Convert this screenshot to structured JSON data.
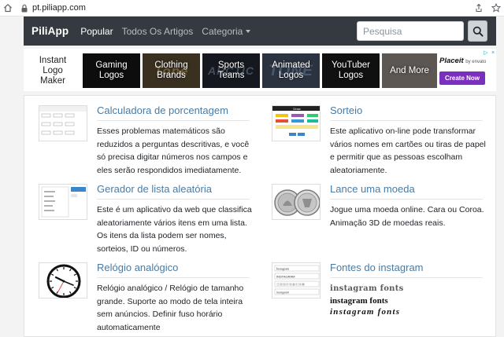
{
  "browser": {
    "url": "pt.piliapp.com"
  },
  "navbar": {
    "brand": "PiliApp",
    "links": [
      "Popular",
      "Todos Os Artigos",
      "Categoria"
    ],
    "search_placeholder": "Pesquisa"
  },
  "ad": {
    "tiles": [
      "Instant Logo Maker",
      "Gaming Logos",
      "Clothing Brands",
      "Sports Teams",
      "Animated Logos",
      "YouTuber Logos",
      "And More"
    ],
    "decor": [
      "",
      "",
      "Tone",
      "ARCTIC",
      "TONE",
      "",
      ""
    ],
    "placeit_logo": "Placeit",
    "placeit_by": "by envato",
    "placeit_button": "Create Now"
  },
  "apps": [
    {
      "title": "Calculadora de porcentagem",
      "description": "Esses problemas matemáticos são reduzidos a perguntas descritivas, e você só precisa digitar números nos campos e eles serão respondidos imediatamente."
    },
    {
      "title": "Sorteio",
      "description": "Este aplicativo on-line pode transformar vários nomes em cartões ou tiras de papel e permitir que as pessoas escolham aleatoriamente.",
      "thumb_label": "Draw"
    },
    {
      "title": "Gerador de lista aleatória",
      "description": "Este é um aplicativo da web que classifica aleatoriamente vários itens em uma lista. Os itens da lista podem ser nomes, sorteios, ID ou números."
    },
    {
      "title": "Lance uma moeda",
      "description": "Jogue uma moeda online. Cara ou Coroa. Animação 3D de moedas reais."
    },
    {
      "title": "Relógio analógico",
      "description": "Relógio analógico / Relógio de tamanho grande. Suporte ao modo de tela inteira sem anúncios. Definir fuso horário automaticamente"
    },
    {
      "title": "Fontes do instagram",
      "description": "",
      "samples": [
        "instagram fonts",
        "instagram fonts",
        "instagram fonts"
      ],
      "thumb_lines": [
        "Instagram",
        "INSTAGRAM",
        "ⓘⓝⓢⓣⓐⓖⓡⓐⓜ",
        "instagram"
      ]
    }
  ],
  "colors": {
    "navbar": "#343a40",
    "link": "#4a7ba3",
    "placeit_button": "#7b2fbe"
  }
}
